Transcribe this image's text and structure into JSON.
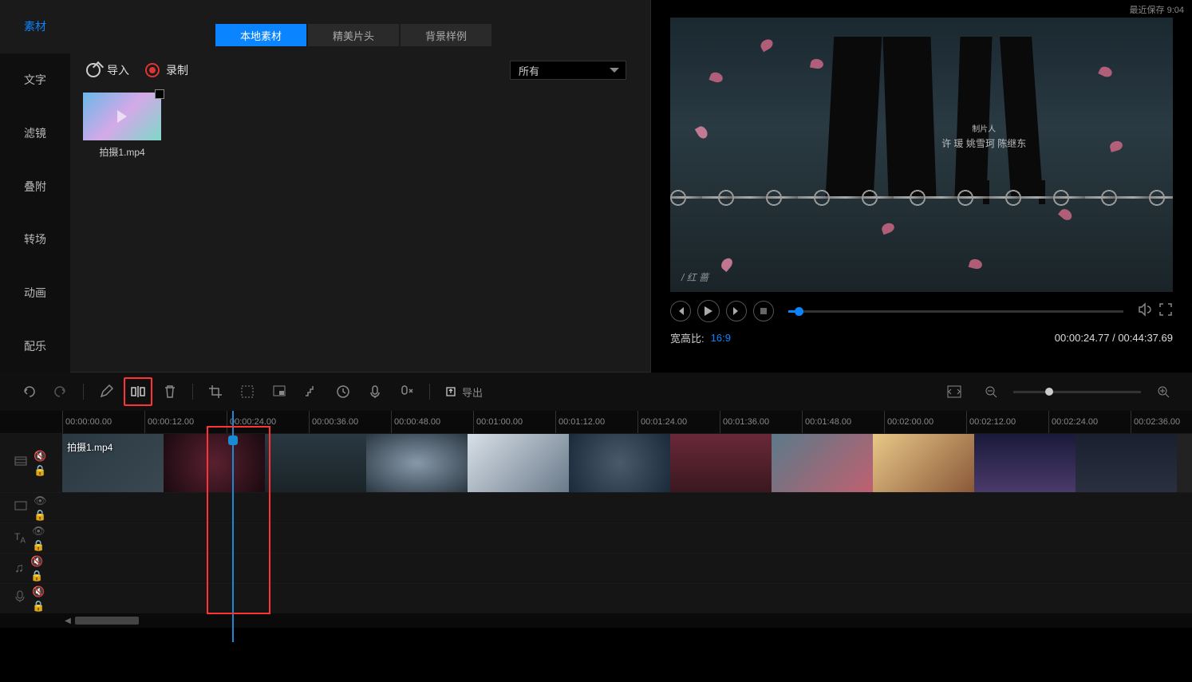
{
  "lastSave": "最近保存 9:04",
  "sidebar": {
    "tabs": [
      {
        "label": "素材",
        "active": true
      },
      {
        "label": "文字",
        "active": false
      },
      {
        "label": "滤镜",
        "active": false
      },
      {
        "label": "叠附",
        "active": false
      },
      {
        "label": "转场",
        "active": false
      },
      {
        "label": "动画",
        "active": false
      },
      {
        "label": "配乐",
        "active": false
      }
    ]
  },
  "materialTabs": [
    {
      "label": "本地素材",
      "active": true
    },
    {
      "label": "精美片头",
      "active": false
    },
    {
      "label": "背景样例",
      "active": false
    }
  ],
  "importLabel": "导入",
  "recordLabel": "录制",
  "filterSelected": "所有",
  "clipItem": {
    "name": "拍摄1.mp4"
  },
  "preview": {
    "creditTitle": "制片人",
    "creditNames": "许 瑗  姚雪珂  陈继东",
    "cornerText": "/ 红 蔷",
    "aspectLabel": "宽高比:",
    "aspectValue": "16:9",
    "currentTime": "00:00:24.77",
    "totalTime": "00:44:37.69"
  },
  "export": "导出",
  "ruler": [
    "00:00:00.00",
    "00:00:12.00",
    "00:00:24.00",
    "00:00:36.00",
    "00:00:48.00",
    "00:01:00.00",
    "00:01:12.00",
    "00:01:24.00",
    "00:01:36.00",
    "00:01:48.00",
    "00:02:00.00",
    "00:02:12.00",
    "00:02:24.00",
    "00:02:36.00"
  ],
  "trackClip": {
    "name": "拍摄1.mp4"
  }
}
